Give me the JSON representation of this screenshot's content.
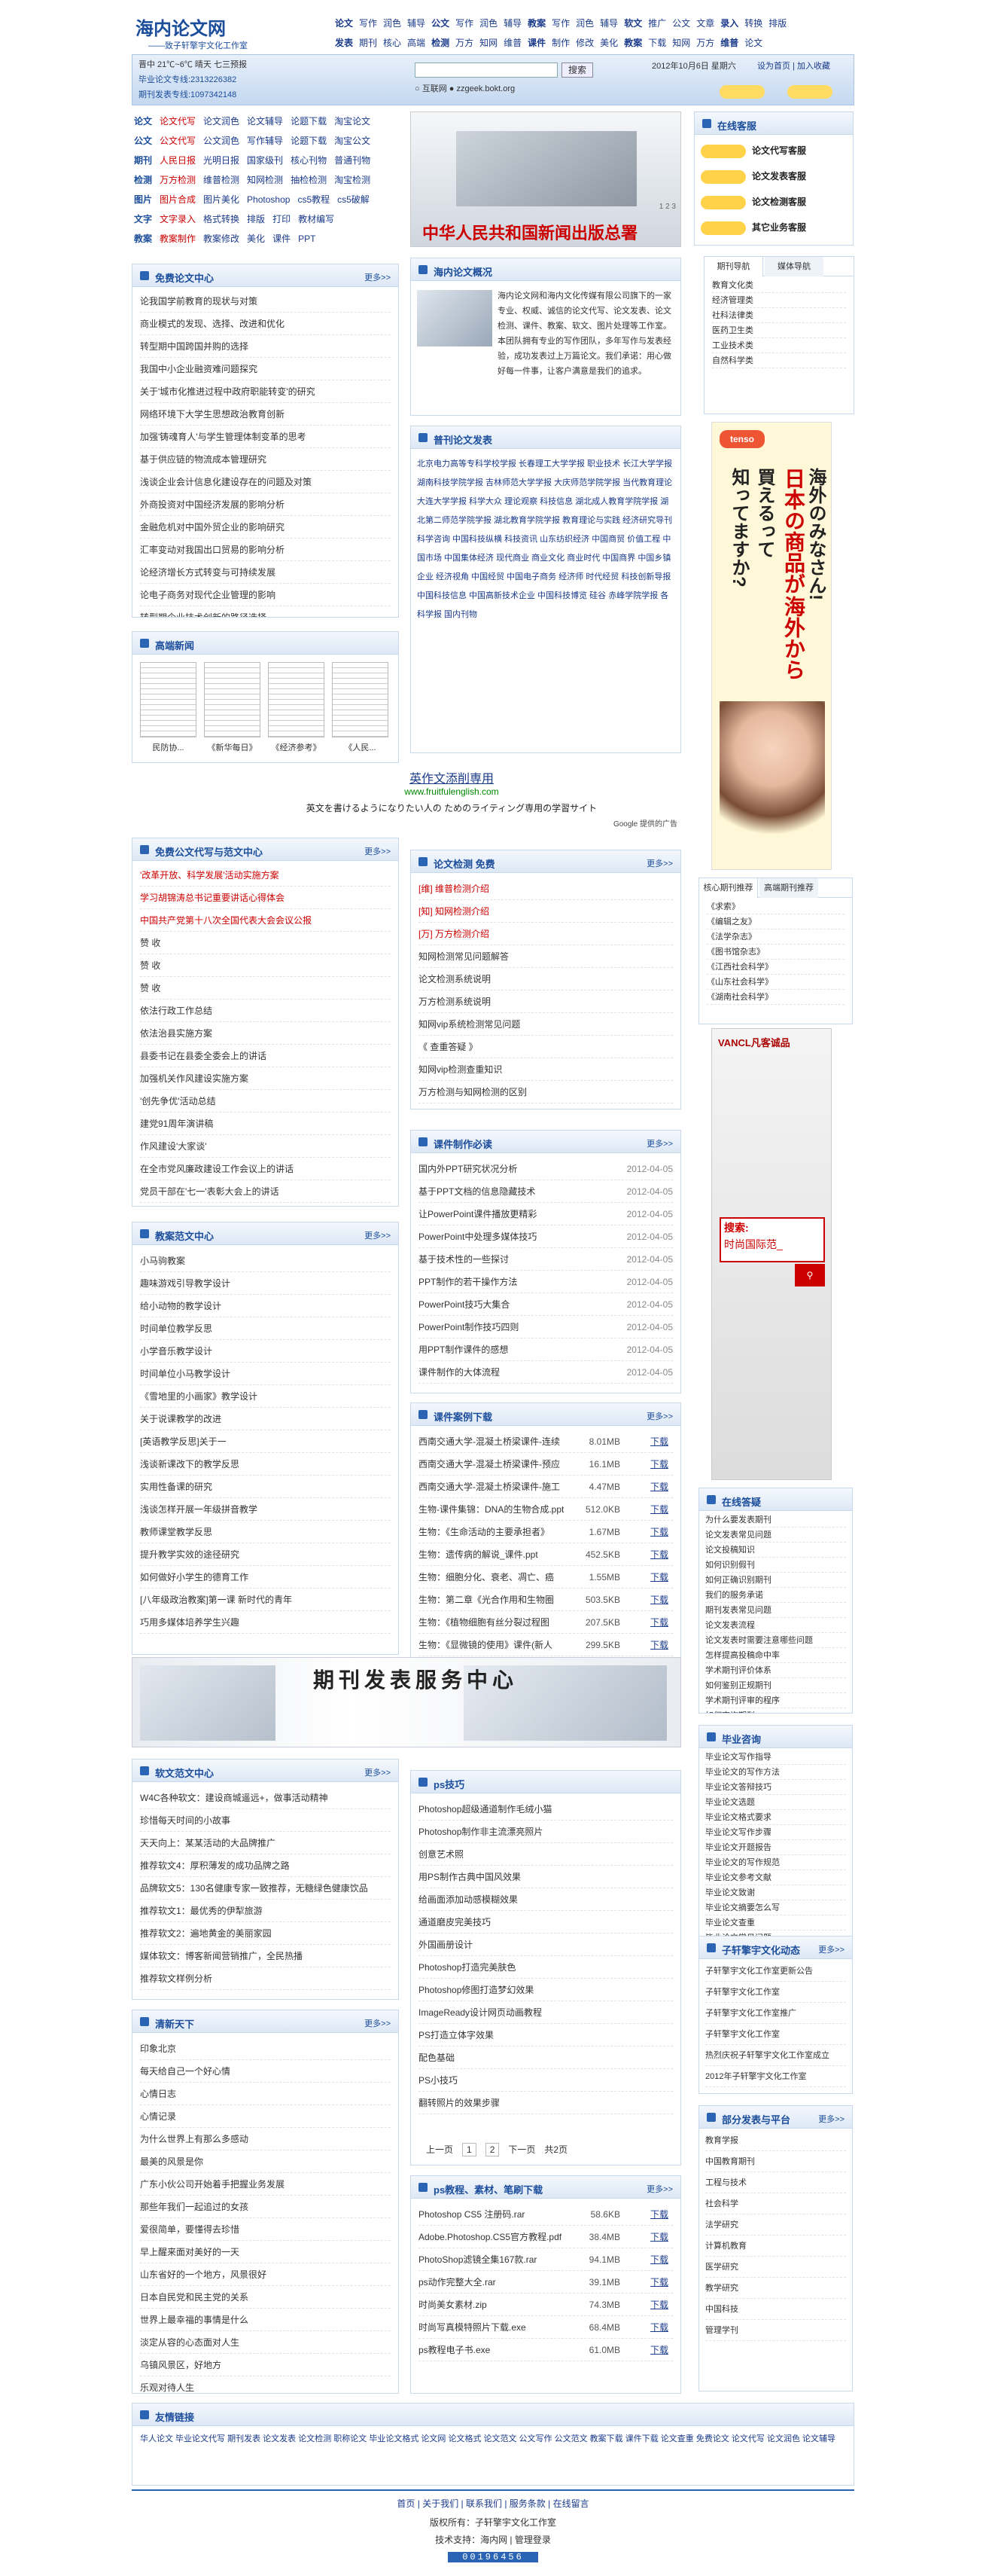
{
  "brand": {
    "logo": "海内论文网",
    "slogan": "——致子轩擎宇文化工作室"
  },
  "topnav": [
    [
      "论文",
      "写作",
      "润色",
      "辅导",
      "公文",
      "写作",
      "润色",
      "辅导",
      "教案",
      "写作",
      "润色",
      "辅导",
      "软文",
      "推广",
      "公文",
      "文章",
      "录入",
      "转换",
      "排版"
    ],
    [
      "发表",
      "期刊",
      "核心",
      "高端",
      "检测",
      "万方",
      "知网",
      "维普",
      "课件",
      "制作",
      "修改",
      "美化",
      "教案",
      "下载",
      "知网",
      "万方",
      "维普",
      "论文"
    ]
  ],
  "contact": {
    "weather": "晋中 21℃~6℃ 晴天 七三预报",
    "line1": "毕业论文专线:2313226382",
    "line2": "期刊发表专线:1097342148",
    "date": "2012年10月6日 星期六",
    "links": "设为首页 | 加入收藏",
    "search_btn": "搜索",
    "radio1": "互联网",
    "radio2": "zzgeek.bokt.org"
  },
  "leftnav": [
    [
      "论文",
      "论文代写",
      "论文润色",
      "论文辅导",
      "论题下载",
      "淘宝论文"
    ],
    [
      "公文",
      "公文代写",
      "公文润色",
      "写作辅导",
      "论题下载",
      "淘宝公文"
    ],
    [
      "期刊",
      "人民日报",
      "光明日报",
      "国家级刊",
      "核心刊物",
      "普通刊物"
    ],
    [
      "检测",
      "万方检测",
      "维普检测",
      "知网检测",
      "抽检检测",
      "淘宝检测"
    ],
    [
      "图片",
      "图片合成",
      "图片美化",
      "Photoshop",
      "cs5教程",
      "cs5破解"
    ],
    [
      "文字",
      "文字录入",
      "格式转换",
      "排版",
      "打印",
      "教材编写"
    ],
    [
      "教案",
      "教案制作",
      "教案修改",
      "美化",
      "课件",
      "PPT"
    ]
  ],
  "banner": {
    "text": "中华人民共和国新闻出版总署",
    "pager": "1 2 3"
  },
  "service": {
    "title": "在线客服",
    "items": [
      "论文代写客服",
      "论文发表客服",
      "论文检测客服",
      "其它业务客服"
    ]
  },
  "free_center": {
    "title": "免费论文中心",
    "items": [
      "论我国学前教育的现状与对策",
      "商业模式的发现、选择、改进和优化",
      "转型期中国跨国并购的选择",
      "我国中小企业融资难问题探究",
      "关于'城市化推进过程中政府职能转变'的研究",
      "网络环境下大学生思想政治教育创新",
      "加强'铸魂育人'与学生管理体制变革的思考",
      "基于供应链的物流成本管理研究",
      "浅谈企业会计信息化建设存在的问题及对策",
      "外商投资对中国经济发展的影响分析",
      "金融危机对中国外贸企业的影响研究",
      "汇率变动对我国出口贸易的影响分析",
      "论经济增长方式转变与可持续发展",
      "论电子商务对现代企业管理的影响",
      "转型期企业技术创新的路径选择"
    ]
  },
  "hot_news": {
    "title": "高端新闻",
    "captions": [
      "民防协...",
      "《新华每日》",
      "《经济参考》",
      "《人民..."
    ]
  },
  "intro": {
    "title": "海内论文概况",
    "text": "海内论文网和海内文化传媒有限公司旗下的一家专业、权威、诚信的论文代写、论文发表、论文检测、课件、教案、软文、图片处理等工作室。本团队拥有专业的写作团队，多年写作与发表经验，成功发表过上万篇论文。我们承诺：用心做好每一件事，让客户满意是我们的追求。",
    "highlight": "论文、公文、发表、检测、课件、教案、软文、图片处理"
  },
  "journals": {
    "title": "普刊论文发表",
    "text": "北京电力高等专科学校学报 长春理工大学学报 职业技术 长江大学学报 湖南科技学院学报 吉林师范大学学报 大庆师范学院学报 当代教育理论 大连大学学报 科学大众 理论观察 科技信息 湖北成人教育学院学报 湖北第二师范学院学报 湖北教育学院学报 教育理论与实践 经济研究导刊 科学咨询 中国科技纵横 科技资讯 山东纺织经济 中国商贸 价值工程 中国市场 中国集体经济 现代商业 商业文化 商业时代 中国商界 中国乡镇企业 经济视角 中国经贸 中国电子商务 经济师 时代经贸 科技创新导报 中国科技信息 中国高新技术企业 中国科技博览 硅谷 赤峰学院学报 各科学报 国内刊物"
  },
  "ad_line": {
    "title": "英作文添削専用",
    "url": "www.fruitfulenglish.com",
    "desc": "英文を書けるようになりたい人の ためのライティング専用の学習サイト",
    "google": "Google 提供的广告"
  },
  "right_tabs": [
    "期刊导航",
    "媒体导航"
  ],
  "right_list": [
    "教育文化类",
    "经济管理类",
    "社科法律类",
    "医药卫生类",
    "工业技术类",
    "自然科学类"
  ],
  "japan_ad": {
    "brand": "tenso",
    "line1": "海外のみなさん!",
    "line2": "日本の商品が",
    "line3": "海外から",
    "line4": "買えるって",
    "line5": "知ってますか?"
  },
  "core_tabs": [
    "核心期刊推荐",
    "高端期刊推荐"
  ],
  "core_list": [
    "《求索》",
    "《编辑之友》",
    "《法学杂志》",
    "《图书馆杂志》",
    "《江西社会科学》",
    "《山东社会科学》",
    "《湖南社会科学》"
  ],
  "vancl": {
    "brand": "VANCL凡客诚品",
    "search": "搜索:",
    "query": "时尚国际范_"
  },
  "gw_center": {
    "title": "免费公文代写与范文中心",
    "items": [
      "'改革开放、科学发展'活动实施方案",
      "学习胡锦涛总书记重要讲话心得体会",
      "中国共产党第十八次全国代表大会会议公报",
      "赞 收",
      "赞 收",
      "赞 收",
      "依法行政工作总结",
      "依法治县实施方案",
      "县委书记在县委全委会上的讲话",
      "加强机关作风建设实施方案",
      "'创先争优'活动总结",
      "建党91周年演讲稿",
      "作风建设'大家谈'",
      "在全市党风廉政建设工作会议上的讲话",
      "党员干部在'七一'表彰大会上的讲话"
    ]
  },
  "check": {
    "title": "论文检测 免费",
    "items": [
      "[维] 维普检测介绍",
      "[知] 知网检测介绍",
      "[万] 万方检测介绍",
      "知网检测常见问题解答",
      "论文检测系统说明",
      "万方检测系统说明",
      "知网vip系统检测常见问题",
      "《 查重答疑 》",
      "知网vip检测查重知识",
      "万方检测与知网检测的区别"
    ]
  },
  "kj_center": {
    "title": "课件制作必读",
    "items": [
      [
        "国内外PPT研究状况分析",
        "2012-04-05"
      ],
      [
        "基于PPT文档的信息隐藏技术",
        "2012-04-05"
      ],
      [
        "让PowerPoint课件播放更精彩",
        "2012-04-05"
      ],
      [
        "PowerPoint中处理多媒体技巧",
        "2012-04-05"
      ],
      [
        "基于技术性的一些探讨",
        "2012-04-05"
      ],
      [
        "PPT制作的若干操作方法",
        "2012-04-05"
      ],
      [
        "PowerPoint技巧大集合",
        "2012-04-05"
      ],
      [
        "PowerPoint制作技巧四则",
        "2012-04-05"
      ],
      [
        "用PPT制作课件的感想",
        "2012-04-05"
      ],
      [
        "课件制作的大体流程",
        "2012-04-05"
      ]
    ]
  },
  "jiaoan": {
    "title": "教案范文中心",
    "items": [
      "小马驹教案",
      "趣味游戏引导教学设计",
      "给小动物的教学设计",
      "时间单位教学反思",
      "小学音乐教学设计",
      "时间单位小马教学设计",
      "《雪地里的小画家》教学设计",
      "关于说课教学的改进",
      "[英语教学反思]关于一",
      "浅谈新课改下的教学反思",
      "实用性备课的研究",
      "浅谈怎样开展一年级拼音教学",
      "教师课堂教学反思",
      "提升教学实效的途径研究",
      "如何做好小学生的德育工作",
      "[八年级政治教案]第一课 新时代的青年",
      "巧用多媒体培养学生兴趣"
    ]
  },
  "down": {
    "title": "课件案例下载",
    "items": [
      [
        "西南交通大学-混凝土桥梁课件-连续",
        "8.01MB",
        "下载"
      ],
      [
        "西南交通大学-混凝土桥梁课件-预应",
        "16.1MB",
        "下载"
      ],
      [
        "西南交通大学-混凝土桥梁课件-施工",
        "4.47MB",
        "下载"
      ],
      [
        "生物-课件集锦：DNA的生物合成.ppt",
        "512.0KB",
        "下载"
      ],
      [
        "生物：《生命活动的主要承担者》",
        "1.67MB",
        "下载"
      ],
      [
        "生物：遗传病的解说_课件.ppt",
        "452.5KB",
        "下载"
      ],
      [
        "生物：细胞分化、衰老、凋亡、癌",
        "1.55MB",
        "下载"
      ],
      [
        "生物：第二章《光合作用和生物圈",
        "503.5KB",
        "下载"
      ],
      [
        "生物：《植物细胞有丝分裂过程图",
        "207.5KB",
        "下载"
      ],
      [
        "生物：《显微镜的使用》课件(新人",
        "299.5KB",
        "下载"
      ]
    ]
  },
  "qk_service": {
    "text": "期刊发表服务中心"
  },
  "rw_center": {
    "title": "软文范文中心",
    "items": [
      "W4C各种软文：建设商城遥远+，做事活动精神",
      "珍惜每天时间的小故事",
      "天天向上：某某活动的大品牌推广",
      "推荐软文4：厚积薄发的成功品牌之路",
      "品牌软文5：130名健康专家一致推荐，无糖绿色健康饮品",
      "推荐软文1：最优秀的伊犁旅游",
      "推荐软文2：遍地黄金的美丽家园",
      "媒体软文：博客新闻营销推广，全民热播",
      "推荐软文样例分析"
    ]
  },
  "qing": {
    "title": "清新天下",
    "items": [
      "印象北京",
      "每天给自己一个好心情",
      "心情日志",
      "心情记录",
      "为什么世界上有那么多感动",
      "最美的风景是你",
      "广东小伙公司开始着手把握业务发展",
      "那些年我们一起追过的女孩",
      "爱很简单，要懂得去珍惜",
      "早上醒来面对美好的一天",
      "山东省好的一个地方，风景很好",
      "日本自民党和民主党的关系",
      "世界上最幸福的事情是什么",
      "淡定从容的心态面对人生",
      "乌镇风景区，好地方",
      "乐观对待人生"
    ]
  },
  "ps": {
    "title": "ps技巧",
    "items": [
      "Photoshop超级通道制作毛绒小猫",
      "Photoshop制作非主流漂亮照片",
      "创意艺术照",
      "用PS制作古典中国风效果",
      "给画面添加动感模糊效果",
      "通道磨皮完美技巧",
      "外国画册设计",
      "Photoshop打造完美肤色",
      "Photoshop修图打造梦幻效果",
      "ImageReady设计网页动画教程",
      "PS打造立体字效果",
      "配色基础",
      "PS小技巧",
      "翻转照片的效果步骤"
    ],
    "pager": [
      "上一页",
      "1",
      "2",
      "下一页",
      "共2页"
    ]
  },
  "ps_down": {
    "title": "ps教程、素材、笔刷下载",
    "items": [
      [
        "Photoshop CS5 注册码.rar",
        "58.6KB",
        "下载"
      ],
      [
        "Adobe.Photoshop.CS5官方教程.pdf",
        "38.4MB",
        "下载"
      ],
      [
        "PhotoShop滤镜全集167款.rar",
        "94.1MB",
        "下载"
      ],
      [
        "ps动作完整大全.rar",
        "39.1MB",
        "下载"
      ],
      [
        "时尚美女素材.zip",
        "74.3MB",
        "下载"
      ],
      [
        "时尚写真模特照片下载.exe",
        "68.4MB",
        "下载"
      ],
      [
        "ps教程电子书.exe",
        "61.0MB",
        "下载"
      ]
    ]
  },
  "answers": {
    "title": "在线答疑",
    "items": [
      "为什么要发表期刊",
      "论文发表常见问题",
      "论文投稿知识",
      "如何识别假刊",
      "如何正确识别期刊",
      "我们的服务承诺",
      "期刊发表常见问题",
      "论文发表流程",
      "论文发表时需要注意哪些问题",
      "怎样提高投稿命中率",
      "学术期刊评价体系",
      "如何鉴别正规期刊",
      "学术期刊评审的程序",
      "如何查询期刊"
    ]
  },
  "grad": {
    "title": "毕业咨询",
    "items": [
      "毕业论文写作指导",
      "毕业论文的写作方法",
      "毕业论文答辩技巧",
      "毕业论文选题",
      "毕业论文格式要求",
      "毕业论文写作步骤",
      "毕业论文开题报告",
      "毕业论文的写作规范",
      "毕业论文参考文献",
      "毕业论文致谢",
      "毕业论文摘要怎么写",
      "毕业论文查重",
      "毕业论文常见问题"
    ]
  },
  "studio": {
    "title": "子轩擎宇文化动态",
    "items": [
      "子轩擎宇文化工作室更新公告",
      "子轩擎宇文化工作室",
      "子轩擎宇文化工作室推广",
      "子轩擎宇文化工作室",
      "热烈庆祝子轩擎宇文化工作室成立",
      "2012年子轩擎宇文化工作室"
    ]
  },
  "partners": {
    "title": "部分发表与平台",
    "items": [
      "教育学报",
      "中国教育期刊",
      "工程与技术",
      "社会科学",
      "法学研究",
      "计算机教育",
      "医学研究",
      "教学研究",
      "中国科技",
      "管理学刊"
    ]
  },
  "links": {
    "title": "友情链接",
    "text": "华人论文 毕业论文代写 期刊发表 论文发表 论文检测 职称论文 毕业论文格式 论文网 论文格式 论文范文 公文写作 公文范文 教案下载 课件下载 论文查重 免费论文 论文代写 论文润色 论文辅导"
  },
  "footer": {
    "nav": "首页 | 关于我们 | 联系我们 | 服务条款 | 在线留言",
    "copy": "版权所有：子轩擎宇文化工作室",
    "tech": "技术支持：海内网 | 管理登录",
    "counter": "00196456"
  }
}
